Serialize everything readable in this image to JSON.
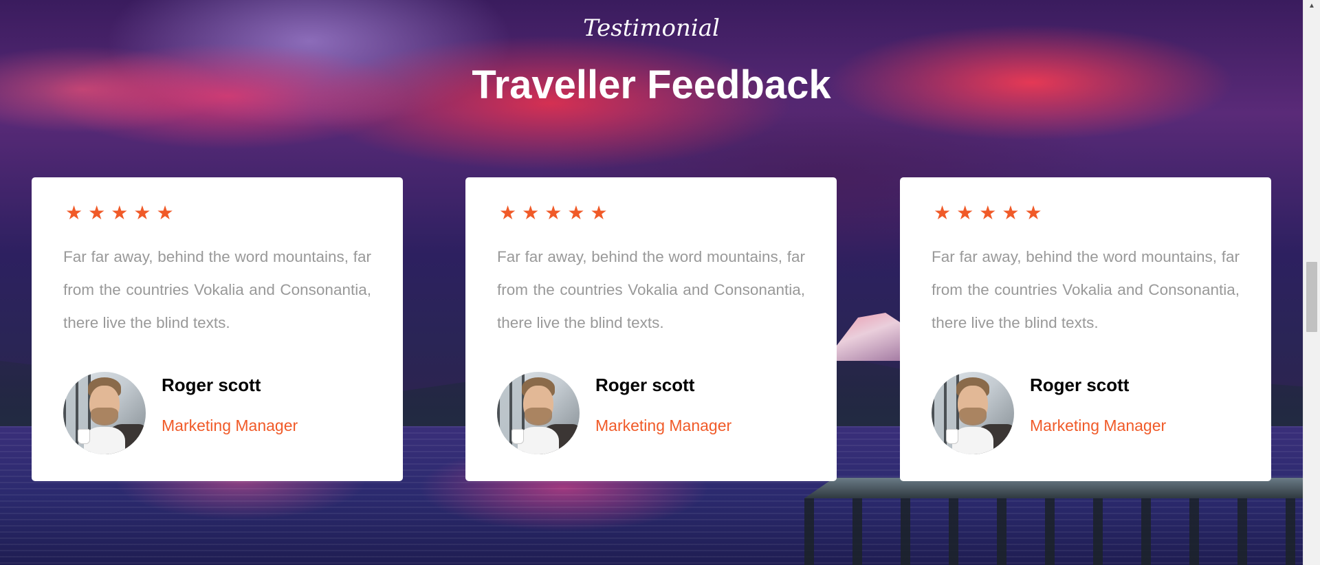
{
  "section": {
    "subheading": "Testimonial",
    "heading": "Traveller Feedback"
  },
  "testimonials": [
    {
      "rating": 5,
      "star_icon": "★",
      "quote": "Far far away, behind the word mountains, far from the countries Vokalia and Consonantia, there live the blind texts.",
      "name": "Roger scott",
      "position": "Marketing Manager"
    },
    {
      "rating": 5,
      "star_icon": "★",
      "quote": "Far far away, behind the word mountains, far from the countries Vokalia and Consonantia, there live the blind texts.",
      "name": "Roger scott",
      "position": "Marketing Manager"
    },
    {
      "rating": 5,
      "star_icon": "★",
      "quote": "Far far away, behind the word mountains, far from the countries Vokalia and Consonantia, there live the blind texts.",
      "name": "Roger scott",
      "position": "Marketing Manager"
    }
  ],
  "scrollbar": {
    "up_arrow_icon": "▲",
    "position_fraction": 0.56
  },
  "colors": {
    "accent": "#f05a28",
    "quote_text": "#999999",
    "heading_text": "#ffffff",
    "card_background": "#ffffff"
  }
}
